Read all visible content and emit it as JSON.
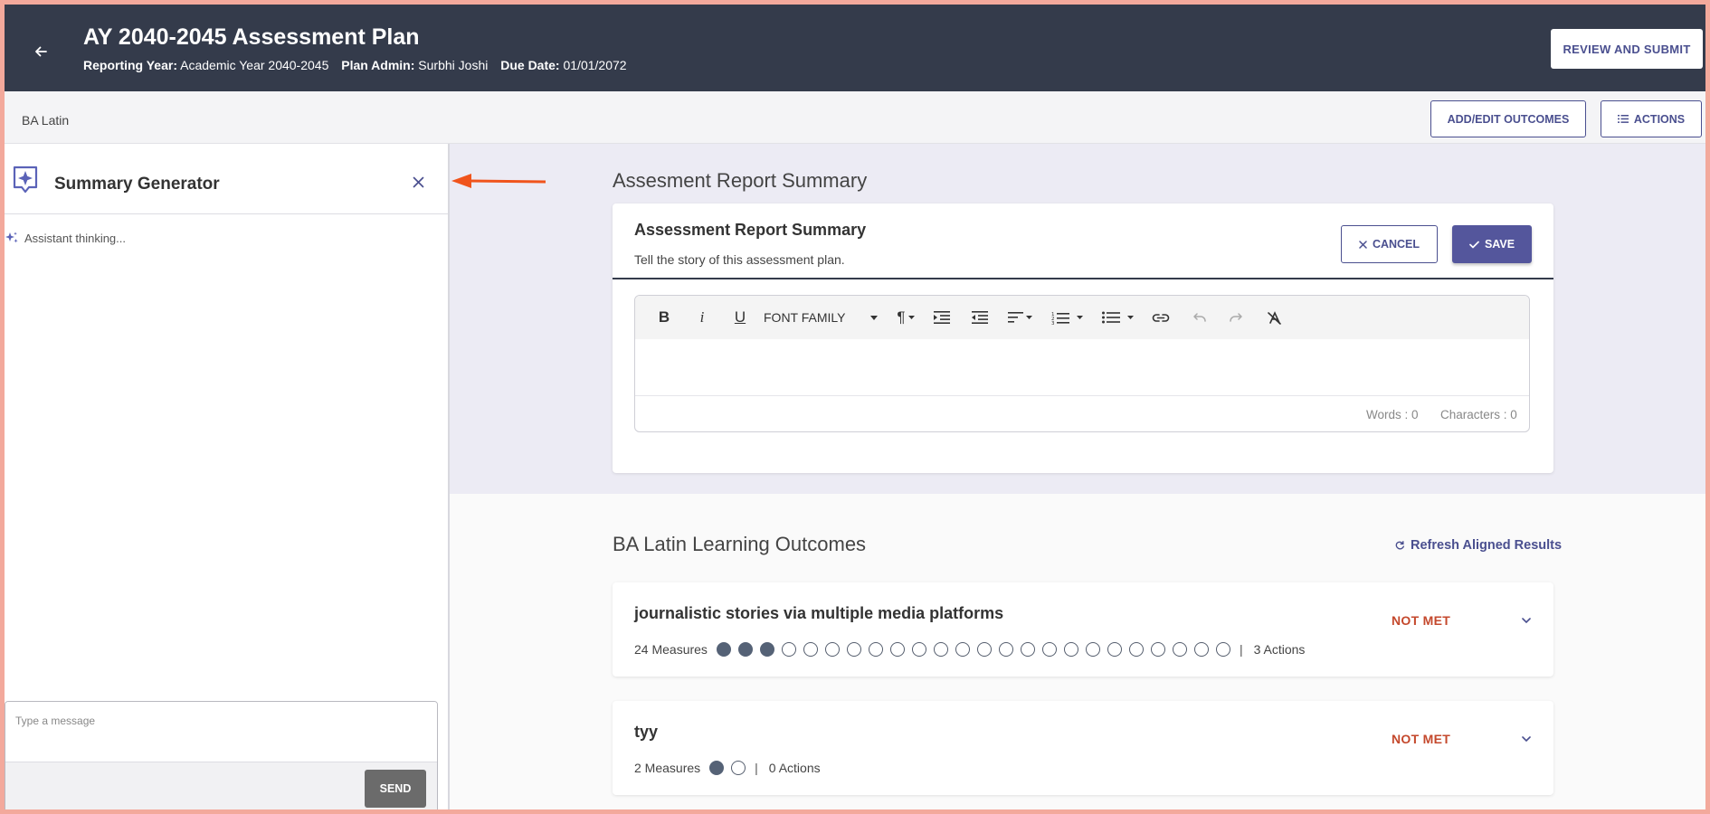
{
  "header": {
    "title": "AY 2040-2045 Assessment Plan",
    "reporting_year_label": "Reporting Year:",
    "reporting_year_value": "Academic Year 2040-2045",
    "plan_admin_label": "Plan Admin:",
    "plan_admin_value": "Surbhi Joshi",
    "due_date_label": "Due Date:",
    "due_date_value": "01/01/2072",
    "review_submit_label": "REVIEW AND SUBMIT"
  },
  "subbar": {
    "program_name": "BA Latin",
    "add_edit_outcomes_label": "ADD/EDIT OUTCOMES",
    "actions_label": "ACTIONS"
  },
  "side_panel": {
    "title": "Summary Generator",
    "status_text": "Assistant thinking...",
    "message_placeholder": "Type a message",
    "send_label": "SEND"
  },
  "summary": {
    "section_title": "Assesment Report Summary",
    "card_title": "Assessment Report Summary",
    "card_subtitle": "Tell the story of this assessment plan.",
    "cancel_label": "CANCEL",
    "save_label": "SAVE",
    "toolbar": {
      "font_family_label": "FONT FAMILY"
    },
    "words_text": "Words : 0",
    "characters_text": "Characters : 0"
  },
  "outcomes": {
    "section_title": "BA Latin Learning Outcomes",
    "refresh_label": "Refresh Aligned Results",
    "items": [
      {
        "name": "journalistic stories via multiple media platforms",
        "measures_text": "24 Measures",
        "measures_total": 24,
        "measures_filled": 3,
        "actions_text": "3 Actions",
        "status": "NOT MET"
      },
      {
        "name": "tyy",
        "measures_text": "2 Measures",
        "measures_total": 2,
        "measures_filled": 1,
        "actions_text": "0 Actions",
        "status": "NOT MET"
      }
    ]
  },
  "colors": {
    "header_bg": "#343b4b",
    "accent": "#4a4f8f",
    "save_bg": "#54569c",
    "status_not_met": "#c4482c",
    "annotation_arrow": "#f0541c"
  }
}
